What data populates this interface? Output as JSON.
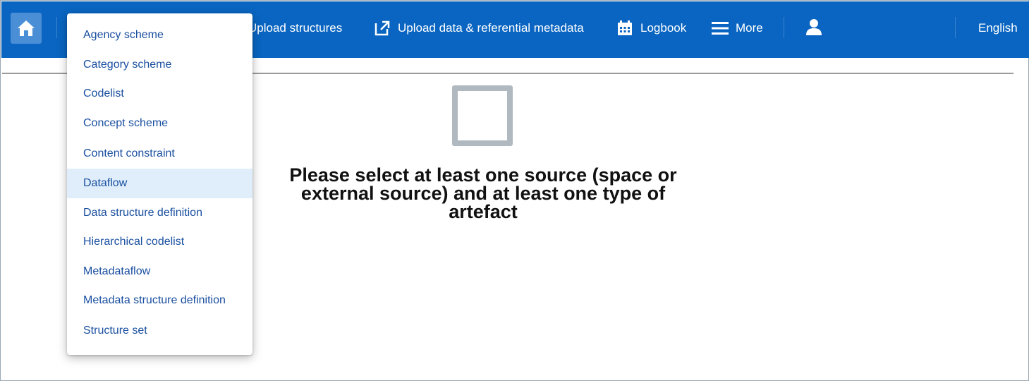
{
  "nav": {
    "upload_structures": "Upload structures",
    "upload_data": "Upload data & referential metadata",
    "logbook": "Logbook",
    "more": "More",
    "language": "English"
  },
  "dropdown": {
    "items": [
      {
        "label": "Agency scheme"
      },
      {
        "label": "Category scheme"
      },
      {
        "label": "Codelist"
      },
      {
        "label": "Concept scheme"
      },
      {
        "label": "Content constraint"
      },
      {
        "label": "Dataflow",
        "active": true
      },
      {
        "label": "Data structure definition"
      },
      {
        "label": "Hierarchical codelist"
      },
      {
        "label": "Metadataflow"
      },
      {
        "label": "Metadata structure definition"
      },
      {
        "label": "Structure set"
      }
    ]
  },
  "main": {
    "empty_message": "Please select at least one source (space or external source) and at least one type of artefact"
  },
  "colors": {
    "navbar": "#0965c1",
    "link": "#1a4fa0",
    "active_item": "#dfeefa"
  }
}
